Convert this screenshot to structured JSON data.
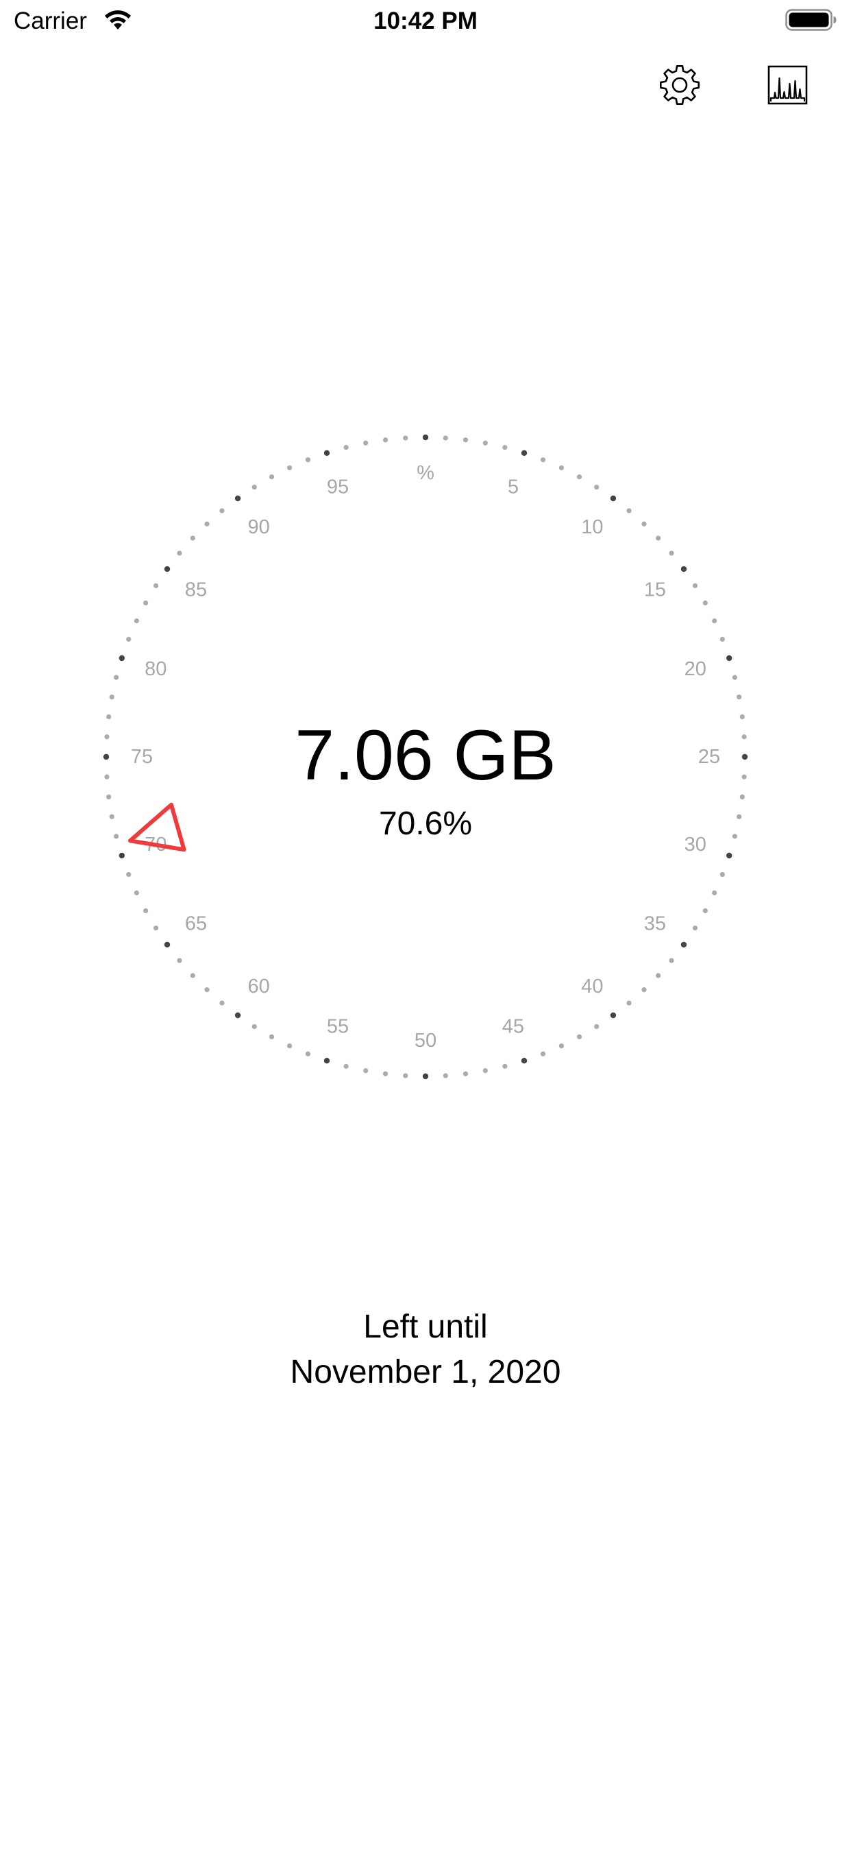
{
  "status_bar": {
    "carrier": "Carrier",
    "time": "10:42 PM",
    "icons": [
      "wifi-icon",
      "battery-icon"
    ]
  },
  "toolbar": {
    "settings_icon": "gear-icon",
    "stats_icon": "bar-chart-icon"
  },
  "gauge": {
    "ticks_total": 100,
    "major_every": 5,
    "labels": [
      "%",
      "5",
      "10",
      "15",
      "20",
      "25",
      "30",
      "35",
      "40",
      "45",
      "50",
      "55",
      "60",
      "65",
      "70",
      "75",
      "80",
      "85",
      "90",
      "95"
    ],
    "pointer_percent": 70.6,
    "colors": {
      "minor_tick": "#ababab",
      "major_tick": "#444444",
      "label": "#a7a7a7",
      "pointer": "#ef3b3b"
    }
  },
  "readout": {
    "amount": "7.06 GB",
    "percent": "70.6%"
  },
  "caption": {
    "line1": "Left until",
    "line2": "November 1, 2020"
  }
}
